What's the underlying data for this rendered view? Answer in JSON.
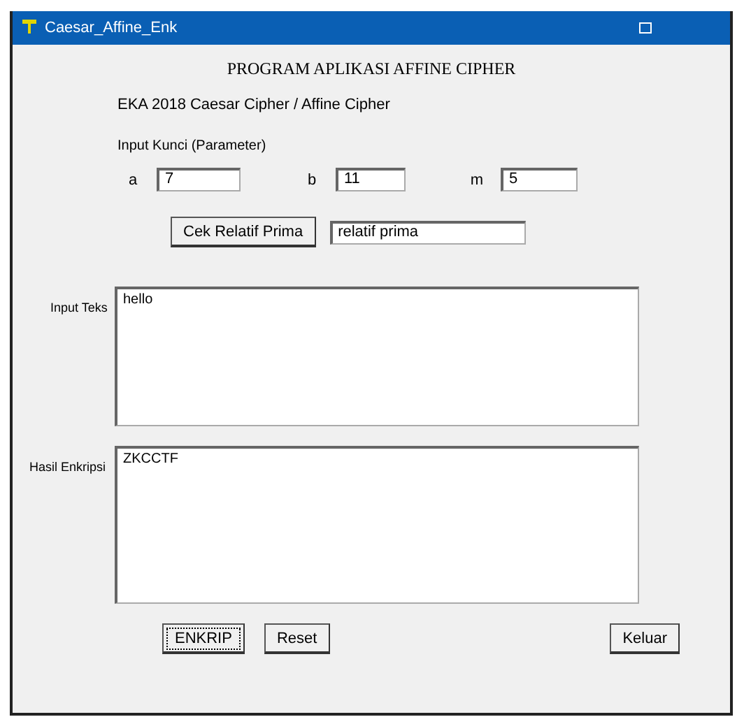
{
  "window": {
    "title": "Caesar_Affine_Enk"
  },
  "heading": "PROGRAM APLIKASI AFFINE CIPHER",
  "subtitle": "EKA 2018 Caesar Cipher / Affine Cipher",
  "section_label": "Input Kunci (Parameter)",
  "params": [
    {
      "label": "a",
      "value": "7"
    },
    {
      "label": "b",
      "value": "11"
    },
    {
      "label": "m",
      "value": "5"
    }
  ],
  "check": {
    "button": "Cek Relatif Prima",
    "result": "relatif prima"
  },
  "input": {
    "label": "Input Teks",
    "value": "hello"
  },
  "output": {
    "label": "Hasil Enkripsi",
    "value": "ZKCCTF"
  },
  "buttons": [
    {
      "label": "ENKRIP",
      "focused": true
    },
    {
      "label": "Reset",
      "focused": false
    },
    {
      "label": "Keluar",
      "focused": false
    }
  ]
}
